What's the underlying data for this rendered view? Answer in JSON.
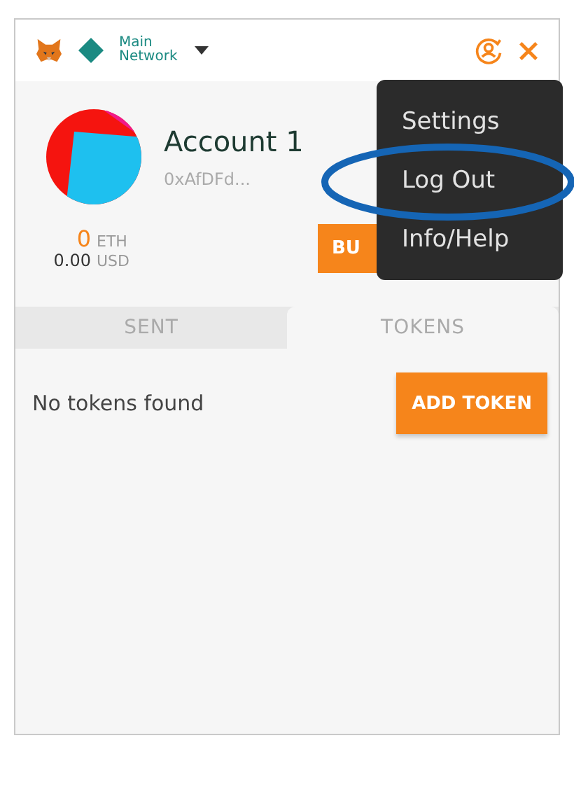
{
  "header": {
    "network": "Main Network"
  },
  "account": {
    "name": "Account 1",
    "address": "0xAfDFd...",
    "balance": "0",
    "balance_unit": "ETH",
    "fiat": "0.00",
    "fiat_unit": "USD"
  },
  "actions": [
    {
      "label": "BU"
    }
  ],
  "tabs": [
    {
      "label": "SENT",
      "selected": false
    },
    {
      "label": "TOKENS",
      "selected": true
    }
  ],
  "tokens": {
    "empty_text": "No tokens found",
    "add_button": "ADD TOKEN"
  },
  "menu": {
    "items": [
      {
        "label": "Settings",
        "highlighted": false
      },
      {
        "label": "Log Out",
        "highlighted": true
      },
      {
        "label": "Info/Help",
        "highlighted": false
      }
    ]
  }
}
